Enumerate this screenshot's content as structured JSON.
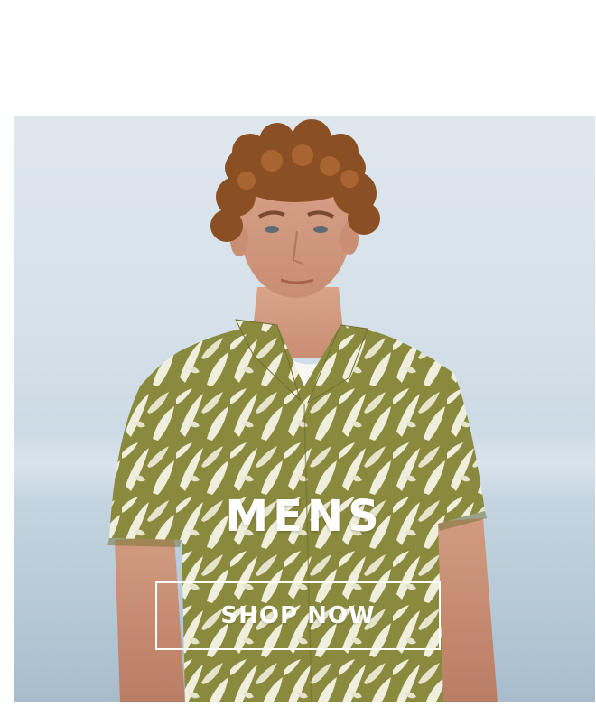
{
  "banner": {
    "title": "MENS",
    "cta_label": "SHOP NOW",
    "image_subject": "man-in-floral-shirt-photo",
    "colors": {
      "sky": "#d6e1ea",
      "shirt_green": "#8a8a3e",
      "shirt_cream": "#f0eedc",
      "text": "#ffffff"
    }
  }
}
